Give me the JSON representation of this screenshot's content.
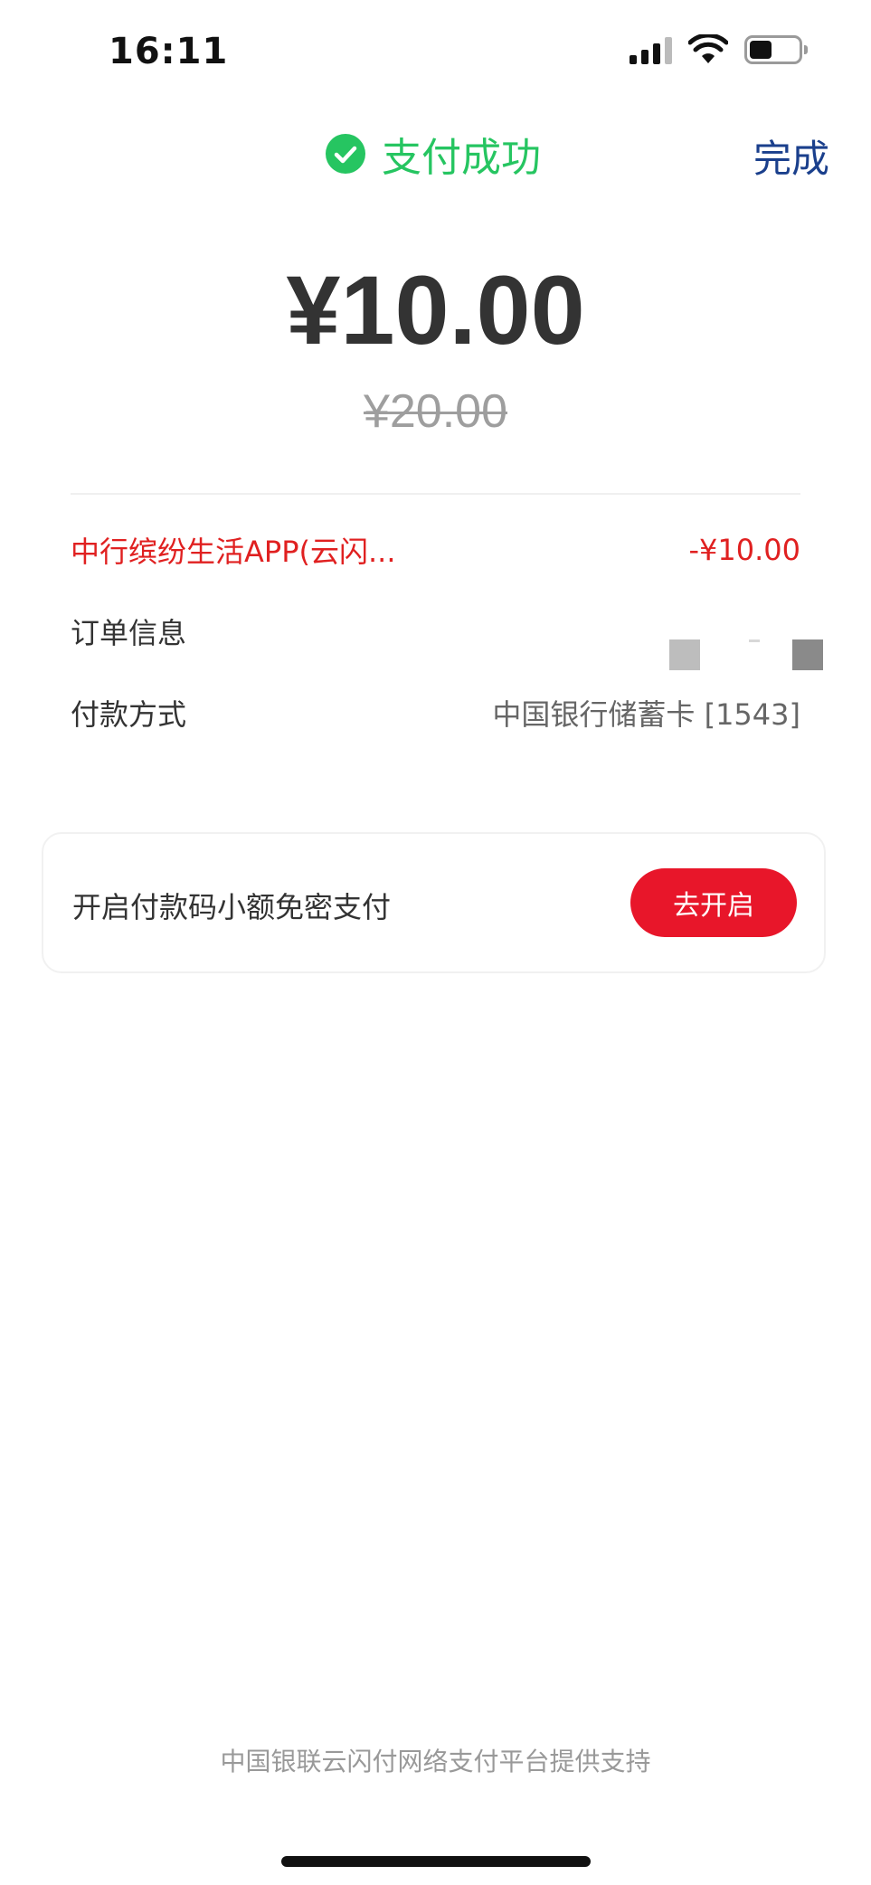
{
  "status_bar": {
    "time": "16:11",
    "icons": [
      "signal-icon",
      "wifi-icon",
      "battery-icon"
    ]
  },
  "header": {
    "title": "支付成功",
    "done_label": "完成",
    "check_icon": "check-circle-icon"
  },
  "payment": {
    "amount": "¥10.00",
    "original_amount": "¥20.00"
  },
  "details": {
    "merchant_label": "中行缤纷生活APP(云闪...",
    "merchant_amount": "-¥10.00",
    "order_label": "订单信息",
    "payment_method_label": "付款方式",
    "payment_method_value": "中国银行储蓄卡 [1543]"
  },
  "promo": {
    "text": "开启付款码小额免密支付",
    "button_label": "去开启"
  },
  "footer": {
    "text": "中国银联云闪付网络支付平台提供支持"
  },
  "colors": {
    "success_green": "#26c561",
    "accent_red": "#e8162a",
    "link_blue": "#1a3f8c"
  }
}
